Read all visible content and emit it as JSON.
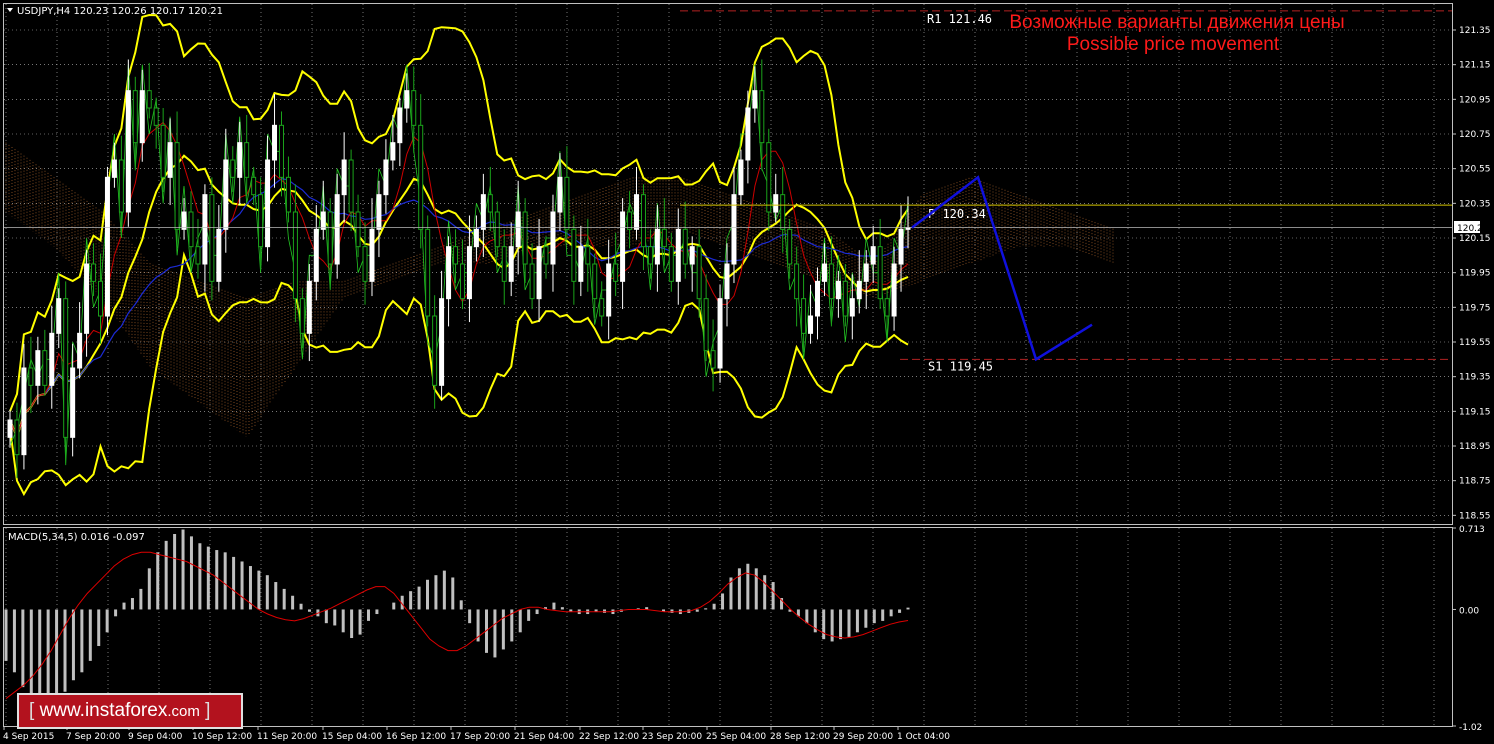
{
  "header": {
    "symbol_label": "USDJPY,H4  120.23 120.26 120.17 120.21"
  },
  "macd_header": "MACD(5,34,5) 0.016 -0.097",
  "annotation": {
    "ru": "Возможные варианты движения цены",
    "en": "Possible price movement"
  },
  "levels": [
    {
      "name": "R1",
      "label": "R1 121.46",
      "value": 121.46,
      "color": "#b22222",
      "style": "dashed"
    },
    {
      "name": "P",
      "label": "P 120.34",
      "value": 120.34,
      "color": "#d4c400",
      "style": "solid"
    },
    {
      "name": "S1",
      "label": "S1 119.45",
      "value": 119.45,
      "color": "#b22222",
      "style": "dashed"
    }
  ],
  "current_price": {
    "value": 120.21,
    "label": "120.21"
  },
  "watermark": {
    "open": "[",
    "text": "www.instaforex",
    "suffix": ".com",
    "close": "]"
  },
  "colors": {
    "candle_up": "#ffffff",
    "candle_down": "#1aa31a",
    "bollinger": "#ffff00",
    "ma_blue": "#1c2bd6",
    "ma_red": "#cc0000",
    "ma_green": "#23c623",
    "forecast": "#1010dd",
    "macd_hist": "#c0c0c0",
    "macd_signal": "#dd0000",
    "grid": "#c0c0c0"
  },
  "chart_data": [
    {
      "type": "candlestick",
      "title": "USDJPY,H4",
      "ylim": [
        118.5,
        121.5
      ],
      "price_ticks": [
        "121.35",
        "121.15",
        "120.95",
        "120.75",
        "120.55",
        "120.35",
        "120.15",
        "119.95",
        "119.75",
        "119.55",
        "119.35",
        "119.15",
        "118.95",
        "118.75",
        "118.55"
      ],
      "time_ticks": [
        "4 Sep 2015",
        "7 Sep 20:00",
        "9 Sep 04:00",
        "10 Sep 12:00",
        "11 Sep 20:00",
        "15 Sep 04:00",
        "16 Sep 12:00",
        "17 Sep 20:00",
        "21 Sep 04:00",
        "22 Sep 12:00",
        "23 Sep 20:00",
        "25 Sep 04:00",
        "28 Sep 12:00",
        "29 Sep 20:00",
        "1 Oct 04:00"
      ],
      "close": [
        119.1,
        118.9,
        119.4,
        119.3,
        119.5,
        119.3,
        119.6,
        119.8,
        119.0,
        119.4,
        119.6,
        120.0,
        119.9,
        119.7,
        120.5,
        120.6,
        120.3,
        121.0,
        120.7,
        121.0,
        120.9,
        120.8,
        120.5,
        120.7,
        120.2,
        120.3,
        120.1,
        120.0,
        120.4,
        119.9,
        120.2,
        120.6,
        120.5,
        120.7,
        120.5,
        120.4,
        120.1,
        120.6,
        120.8,
        120.5,
        120.3,
        119.8,
        119.6,
        119.9,
        120.2,
        120.3,
        120.0,
        120.4,
        120.6,
        120.3,
        120.1,
        119.9,
        120.2,
        120.4,
        120.6,
        120.7,
        120.9,
        121.0,
        120.8,
        120.2,
        119.7,
        119.3,
        119.8,
        120.1,
        120.0,
        119.8,
        120.1,
        120.2,
        120.4,
        120.3,
        120.1,
        119.9,
        120.1,
        120.3,
        120.0,
        119.8,
        120.1,
        120.0,
        120.3,
        120.5,
        120.2,
        119.9,
        120.1,
        120.0,
        119.8,
        119.7,
        120.0,
        119.9,
        120.3,
        120.2,
        120.4,
        120.1,
        120.0,
        120.2,
        120.1,
        119.9,
        120.2,
        120.0,
        120.1,
        119.8,
        119.5,
        119.4,
        119.8,
        120.0,
        120.4,
        120.6,
        120.9,
        121.0,
        120.7,
        120.3,
        120.4,
        120.2,
        120.0,
        119.8,
        119.6,
        119.7,
        119.9,
        120.0,
        119.8,
        119.9,
        119.7,
        119.8,
        119.9,
        120.0,
        120.1,
        119.8,
        119.7,
        120.0,
        120.2,
        120.21
      ],
      "ichimoku_cloud": {
        "top": [
          120.7,
          120.5,
          120.3,
          120.0,
          119.9,
          119.8,
          119.9,
          119.9,
          120.0,
          120.1,
          120.2,
          120.3,
          120.4,
          120.5,
          120.5,
          120.4,
          120.3,
          120.2,
          120.0,
          120.4,
          120.5,
          120.4,
          120.3,
          120.2
        ],
        "bottom": [
          120.3,
          120.1,
          119.8,
          119.4,
          119.2,
          119.0,
          119.4,
          119.8,
          119.9,
          120.0,
          120.0,
          120.1,
          120.1,
          120.1,
          120.2,
          120.1,
          120.0,
          119.9,
          119.8,
          119.9,
          120.0,
          120.1,
          120.1,
          120.0
        ]
      },
      "forecast_path": [
        120.21,
        120.5,
        119.45,
        119.65
      ]
    },
    {
      "type": "bar",
      "title": "MACD(5,34,5) 0.016 -0.097",
      "ylim": [
        -1.02,
        0.713
      ],
      "ticks": [
        "0.713",
        "0.00",
        "-1.02"
      ],
      "histogram": [
        -0.45,
        -0.55,
        -0.68,
        -0.78,
        -0.85,
        -0.88,
        -0.82,
        -0.72,
        -0.62,
        -0.55,
        -0.45,
        -0.32,
        -0.2,
        -0.06,
        0.06,
        0.1,
        0.18,
        0.36,
        0.5,
        0.6,
        0.66,
        0.7,
        0.64,
        0.58,
        0.55,
        0.52,
        0.5,
        0.46,
        0.42,
        0.38,
        0.34,
        0.3,
        0.24,
        0.18,
        0.12,
        0.05,
        -0.02,
        -0.06,
        -0.12,
        -0.14,
        -0.2,
        -0.25,
        -0.22,
        -0.1,
        -0.04,
        0.0,
        0.06,
        0.12,
        0.16,
        0.2,
        0.26,
        0.3,
        0.34,
        0.28,
        0.08,
        -0.12,
        -0.28,
        -0.38,
        -0.42,
        -0.35,
        -0.28,
        -0.2,
        -0.1,
        -0.04,
        0.02,
        0.06,
        0.02,
        -0.02,
        -0.04,
        -0.04,
        -0.02,
        -0.03,
        -0.04,
        -0.02,
        0.0,
        0.01,
        0.02,
        0.0,
        -0.02,
        -0.03,
        -0.04,
        -0.03,
        -0.02,
        0.01,
        0.05,
        0.14,
        0.28,
        0.36,
        0.4,
        0.36,
        0.3,
        0.24,
        0.1,
        -0.02,
        -0.06,
        -0.12,
        -0.2,
        -0.26,
        -0.28,
        -0.26,
        -0.24,
        -0.2,
        -0.16,
        -0.12,
        -0.1,
        -0.06,
        -0.03,
        0.016
      ],
      "signal": [
        -0.78,
        -0.72,
        -0.66,
        -0.58,
        -0.48,
        -0.36,
        -0.22,
        -0.08,
        0.04,
        0.14,
        0.22,
        0.3,
        0.38,
        0.44,
        0.48,
        0.5,
        0.5,
        0.48,
        0.46,
        0.44,
        0.42,
        0.38,
        0.34,
        0.3,
        0.24,
        0.18,
        0.12,
        0.06,
        0.0,
        -0.04,
        -0.07,
        -0.09,
        -0.1,
        -0.08,
        -0.05,
        -0.02,
        0.01,
        0.05,
        0.09,
        0.13,
        0.17,
        0.2,
        0.2,
        0.14,
        0.04,
        -0.06,
        -0.16,
        -0.26,
        -0.32,
        -0.36,
        -0.36,
        -0.32,
        -0.26,
        -0.2,
        -0.14,
        -0.08,
        -0.04,
        0.0,
        0.02,
        0.02,
        0.0,
        -0.01,
        -0.02,
        -0.02,
        -0.02,
        -0.02,
        -0.02,
        -0.02,
        -0.01,
        0.0,
        0.0,
        0.0,
        -0.01,
        -0.02,
        -0.02,
        -0.02,
        -0.01,
        0.02,
        0.07,
        0.14,
        0.22,
        0.28,
        0.32,
        0.3,
        0.24,
        0.16,
        0.08,
        0.0,
        -0.07,
        -0.13,
        -0.18,
        -0.22,
        -0.24,
        -0.25,
        -0.24,
        -0.22,
        -0.19,
        -0.16,
        -0.13,
        -0.11,
        -0.097
      ]
    }
  ]
}
